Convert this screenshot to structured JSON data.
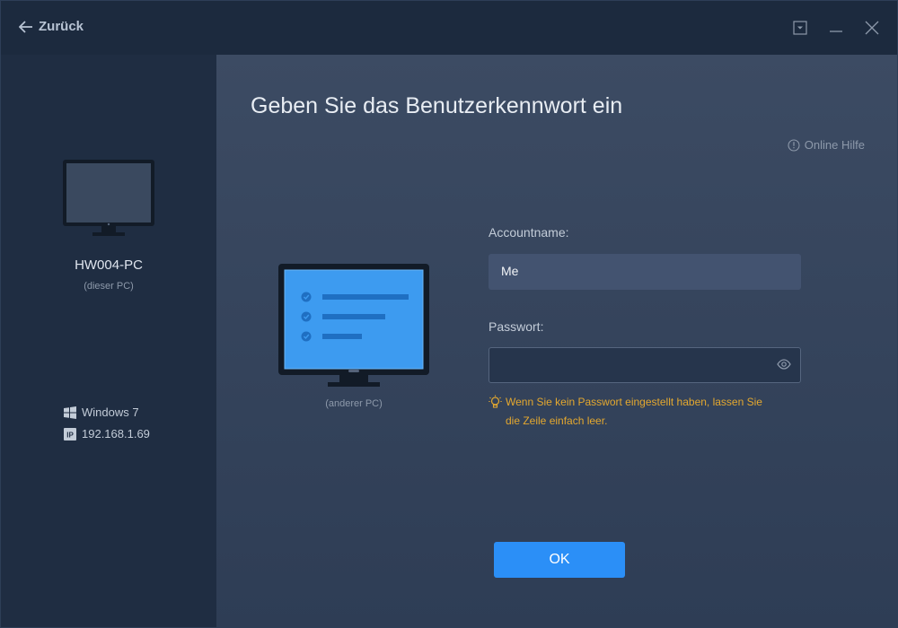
{
  "titlebar": {
    "back_label": "Zurück",
    "controls": [
      "dropdown-icon",
      "minimize-icon",
      "close-icon"
    ]
  },
  "sidebar": {
    "pc_name": "HW004-PC",
    "pc_subtitle": "(dieser PC)",
    "os": "Windows 7",
    "ip": "192.168.1.69"
  },
  "main": {
    "heading": "Geben Sie das Benutzerkennwort ein",
    "help_label": "Online Hilfe",
    "other_pc_label": "(anderer PC)",
    "account_label": "Accountname:",
    "account_value": "Me",
    "password_label": "Passwort:",
    "password_value": "",
    "hint": "Wenn Sie kein Passwort eingestellt haben, lassen Sie die Zeile einfach leer.",
    "ok_label": "OK"
  },
  "colors": {
    "accent": "#2b8ff7",
    "hint": "#e4a82f",
    "sidebar_bg": "#1f2d42",
    "main_bg": "#3c4b63",
    "screen_blue": "#3d9bf0"
  }
}
